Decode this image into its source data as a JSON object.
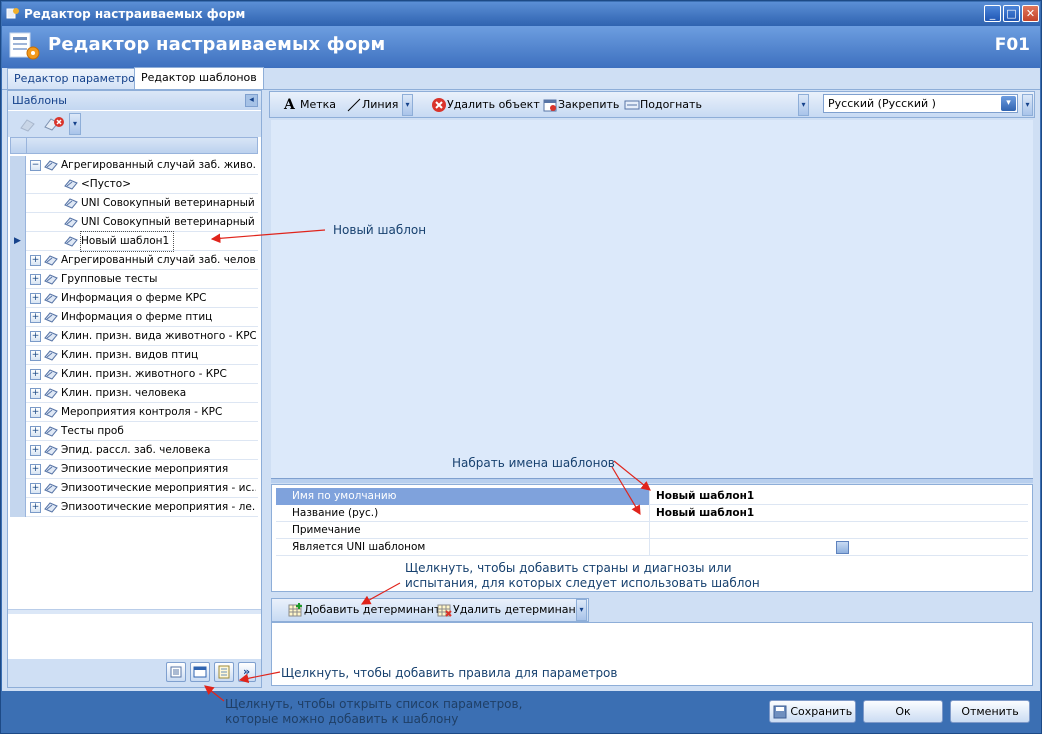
{
  "window": {
    "title": "Редактор настраиваемых форм"
  },
  "header": {
    "title": "Редактор настраиваемых форм",
    "code": "F01"
  },
  "tabs": [
    {
      "label": "Редактор параметров",
      "active": false
    },
    {
      "label": "Редактор шаблонов",
      "active": true
    }
  ],
  "left_panel": {
    "title": "Шаблоны",
    "tree": [
      {
        "label": "Агрегированный случай заб. живо...",
        "level": 0,
        "expand": "minus"
      },
      {
        "label": "<Пусто>",
        "level": 1
      },
      {
        "label": "UNI Совокупный ветеринарный ...",
        "level": 1
      },
      {
        "label": "UNI Совокупный ветеринарный ...",
        "level": 1
      },
      {
        "label": "Новый шаблон1",
        "level": 1,
        "selected": true
      },
      {
        "label": "Агрегированный случай заб. челов...",
        "level": 0,
        "expand": "plus"
      },
      {
        "label": "Групповые тесты",
        "level": 0,
        "expand": "plus"
      },
      {
        "label": "Информация о ферме КРС",
        "level": 0,
        "expand": "plus"
      },
      {
        "label": "Информация о ферме птиц",
        "level": 0,
        "expand": "plus"
      },
      {
        "label": "Клин. призн. вида животного - КРС",
        "level": 0,
        "expand": "plus"
      },
      {
        "label": "Клин. призн. видов птиц",
        "level": 0,
        "expand": "plus"
      },
      {
        "label": "Клин. призн. животного - КРС",
        "level": 0,
        "expand": "plus"
      },
      {
        "label": "Клин. призн. человека",
        "level": 0,
        "expand": "plus"
      },
      {
        "label": "Мероприятия контроля - КРС",
        "level": 0,
        "expand": "plus"
      },
      {
        "label": "Тесты проб",
        "level": 0,
        "expand": "plus"
      },
      {
        "label": "Эпид. рассл. заб. человека",
        "level": 0,
        "expand": "plus"
      },
      {
        "label": "Эпизоотические мероприятия",
        "level": 0,
        "expand": "plus"
      },
      {
        "label": "Эпизоотические мероприятия - ис...",
        "level": 0,
        "expand": "plus"
      },
      {
        "label": "Эпизоотические мероприятия - ле...",
        "level": 0,
        "expand": "plus"
      }
    ]
  },
  "toolbar": {
    "label_btn": "Метка",
    "line_btn": "Линия",
    "delete_btn": "Удалить объект",
    "pin_btn": "Закрепить",
    "fit_btn": "Подогнать",
    "language": "Русский  (Русский )"
  },
  "properties": [
    {
      "name": "Имя по умолчанию",
      "value": "Новый шаблон1",
      "selected": true
    },
    {
      "name": "Название (рус.)",
      "value": "Новый шаблон1"
    },
    {
      "name": "Примечание",
      "value": ""
    },
    {
      "name": "Является UNI шаблоном",
      "value": ""
    }
  ],
  "determinant_toolbar": {
    "add": "Добавить детерминант",
    "remove": "Удалить детерминант"
  },
  "buttons": {
    "save": "Сохранить",
    "ok": "Ок",
    "cancel": "Отменить"
  },
  "annotations": {
    "new_template": "Новый шаблон",
    "type_names": "Набрать имена шаблонов",
    "add_countries_1": "Щелкнуть, чтобы добавить страны и диагнозы или",
    "add_countries_2": "испытания, для которых следует использовать шаблон",
    "add_rules": "Щелкнуть, чтобы добавить правила для параметров",
    "open_params_1": "Щелкнуть, чтобы открыть список параметров,",
    "open_params_2": "которые можно добавить к шаблону"
  },
  "colors": {
    "arrow": "#e0241b",
    "accent": "#3b6fb3"
  }
}
